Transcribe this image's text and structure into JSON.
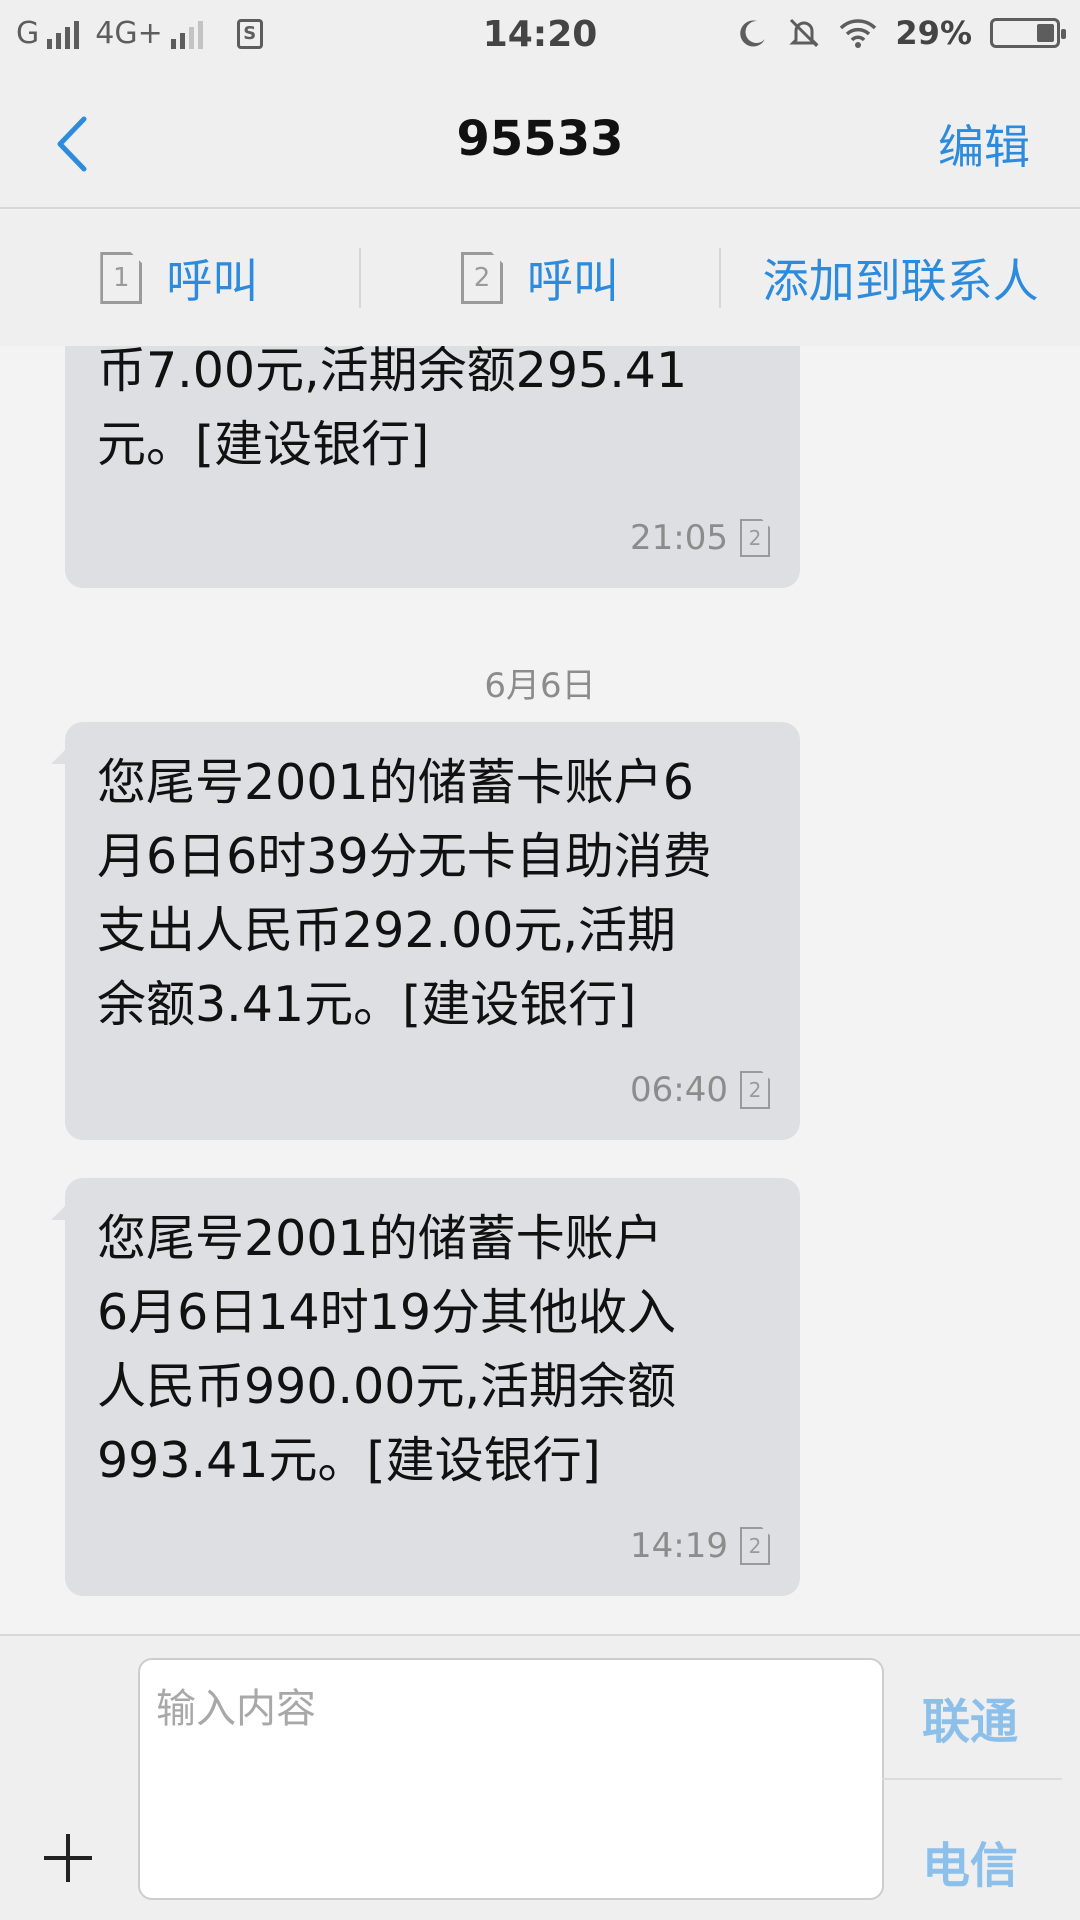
{
  "status_bar": {
    "sim1_label": "G",
    "sim2_label": "4G+",
    "sms_icon_label": "S",
    "time": "14:20",
    "battery": "29%",
    "battery_level": 0.29,
    "icons": [
      "moon-icon",
      "mute-bell-icon",
      "wifi-icon",
      "battery-icon"
    ]
  },
  "header": {
    "title": "95533",
    "edit_label": "编辑"
  },
  "actions": {
    "call_sim1_label": "呼叫",
    "call_sim1_sim": "1",
    "call_sim2_label": "呼叫",
    "call_sim2_sim": "2",
    "add_contact_label": "添加到联系人"
  },
  "messages": [
    {
      "text": "币7.00元,活期余额295.41\n元。[建设银行]",
      "time": "21:05",
      "sim": "2"
    },
    {
      "date": "6月6日"
    },
    {
      "text": "您尾号2001的储蓄卡账户6\n月6日6时39分无卡自助消费\n支出人民币292.00元,活期\n余额3.41元。[建设银行]",
      "time": "06:40",
      "sim": "2"
    },
    {
      "text": "您尾号2001的储蓄卡账户\n6月6日14时19分其他收入\n人民币990.00元,活期余额\n993.41元。[建设银行]",
      "time": "14:19",
      "sim": "2"
    }
  ],
  "composer": {
    "placeholder": "输入内容",
    "send_unicom_label": "联通",
    "send_telecom_label": "电信"
  },
  "colors": {
    "accent": "#2c8bdc",
    "accent_light": "#8cc0ea",
    "bubble": "#dedfe2",
    "background": "#f3f3f4"
  }
}
